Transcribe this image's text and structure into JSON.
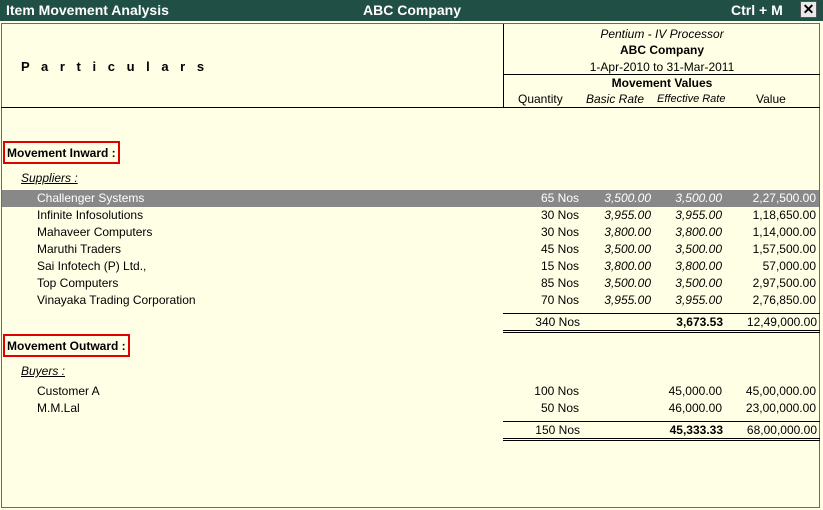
{
  "window": {
    "title": "Item Movement Analysis",
    "company": "ABC Company",
    "shortcut": "Ctrl + M",
    "close_glyph": "✕"
  },
  "header": {
    "particulars_label": "P a r t i c u l a r s",
    "item_name": "Pentium - IV Processor",
    "company": "ABC Company",
    "period": "1-Apr-2010 to 31-Mar-2011",
    "movement_values_label": "Movement Values",
    "columns": {
      "quantity": "Quantity",
      "basic_rate": "Basic Rate",
      "effective_rate": "Effective Rate",
      "value": "Value"
    }
  },
  "inward": {
    "label": "Movement Inward :",
    "group_label": "Suppliers :",
    "rows": [
      {
        "name": "Challenger Systems",
        "qty": "65 Nos",
        "basic_rate": "3,500.00",
        "eff_rate": "3,500.00",
        "value": "2,27,500.00",
        "selected": true
      },
      {
        "name": "Infinite Infosolutions",
        "qty": "30 Nos",
        "basic_rate": "3,955.00",
        "eff_rate": "3,955.00",
        "value": "1,18,650.00"
      },
      {
        "name": "Mahaveer Computers",
        "qty": "30 Nos",
        "basic_rate": "3,800.00",
        "eff_rate": "3,800.00",
        "value": "1,14,000.00"
      },
      {
        "name": "Maruthi Traders",
        "qty": "45 Nos",
        "basic_rate": "3,500.00",
        "eff_rate": "3,500.00",
        "value": "1,57,500.00"
      },
      {
        "name": "Sai Infotech (P) Ltd.,",
        "qty": "15 Nos",
        "basic_rate": "3,800.00",
        "eff_rate": "3,800.00",
        "value": "57,000.00"
      },
      {
        "name": "Top Computers",
        "qty": "85 Nos",
        "basic_rate": "3,500.00",
        "eff_rate": "3,500.00",
        "value": "2,97,500.00"
      },
      {
        "name": "Vinayaka Trading Corporation",
        "qty": "70 Nos",
        "basic_rate": "3,955.00",
        "eff_rate": "3,955.00",
        "value": "2,76,850.00"
      }
    ],
    "total": {
      "qty": "340 Nos",
      "eff_rate": "3,673.53",
      "value": "12,49,000.00"
    }
  },
  "outward": {
    "label": "Movement Outward :",
    "group_label": "Buyers :",
    "rows": [
      {
        "name": "Customer A",
        "qty": "100 Nos",
        "eff_rate": "45,000.00",
        "value": "45,00,000.00"
      },
      {
        "name": "M.M.Lal",
        "qty": "50 Nos",
        "eff_rate": "46,000.00",
        "value": "23,00,000.00"
      }
    ],
    "total": {
      "qty": "150 Nos",
      "eff_rate": "45,333.33",
      "value": "68,00,000.00"
    }
  },
  "colors": {
    "titlebar": "#1f4f45",
    "background": "#ffffe6",
    "selected_row": "#888888",
    "section_border": "#e00000"
  }
}
